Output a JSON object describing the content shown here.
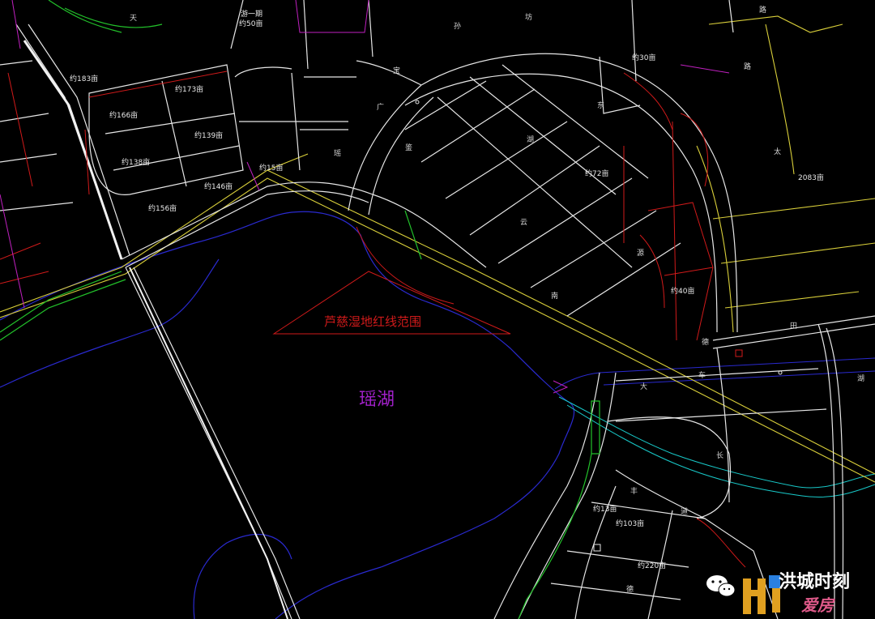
{
  "drawing": {
    "redline_area_label": "芦慈湿地红线范围",
    "lake_name": "瑶湖"
  },
  "parcel_labels": [
    "约183亩",
    "约173亩",
    "约166亩",
    "约139亩",
    "约138亩",
    "约146亩",
    "约156亩",
    "约15亩",
    "约50亩",
    "约72亩",
    "约40亩",
    "约103亩",
    "约220亩",
    "约13亩",
    "2083亩",
    "约30亩",
    "游一期"
  ],
  "road_chars": [
    "天",
    "孙",
    "坊",
    "宝",
    "广",
    "瑶",
    "鉴",
    "东",
    "路",
    "湖",
    "云",
    "南",
    "源",
    "德",
    "路",
    "太",
    "田",
    "湖",
    "大",
    "车",
    "长",
    "丰",
    "道",
    "德"
  ],
  "watermark": {
    "account": "洪城时刻",
    "brand": "爱房",
    "wechat_icon": "wechat-icon"
  },
  "colors": {
    "background": "#000000",
    "road": "#e6e6e6",
    "redline": "#d01a1a",
    "yellow_corridor": "#d9cf3a",
    "water_blue": "#2222c8",
    "cyan_river": "#18c8c8",
    "green_belt": "#22c02a",
    "lake_label": "#a020c8",
    "magenta_lines": "#c020c0"
  }
}
